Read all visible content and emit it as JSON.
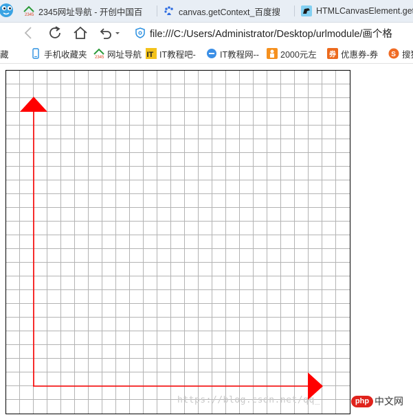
{
  "tabs": [
    {
      "title": "2345网址导航 - 开创中国百",
      "icon": "2345-logo-icon"
    },
    {
      "title": "canvas.getContext_百度搜",
      "icon": "baidu-paw-icon"
    },
    {
      "title": "HTMLCanvasElement.getC",
      "icon": "mdn-dino-icon"
    }
  ],
  "address": {
    "url": "file:///C:/Users/Administrator/Desktop/urlmodule/画个格"
  },
  "bookmarks": [
    {
      "label": "藏",
      "icon": ""
    },
    {
      "label": "手机收藏夹",
      "icon": "phone-icon"
    },
    {
      "label": "网址导航",
      "icon": "2345-logo-icon"
    },
    {
      "label": "IT教程吧-",
      "icon": "it-logo-icon"
    },
    {
      "label": "IT教程网--",
      "icon": "blue-circle-icon"
    },
    {
      "label": "2000元左",
      "icon": "orange-man-icon"
    },
    {
      "label": "优惠券-券",
      "icon": "coupon-icon"
    },
    {
      "label": "搜狗",
      "icon": "sogou-icon"
    }
  ],
  "watermark": "https://blog.csdn.net/qq_",
  "php_logo": {
    "badge": "php",
    "text": "中文网"
  },
  "colors": {
    "arrow": "#ff0000",
    "grid": "#b3b3b3",
    "border": "#000000"
  },
  "grid": {
    "spacing": 20,
    "columns": 25,
    "rows": 25
  }
}
